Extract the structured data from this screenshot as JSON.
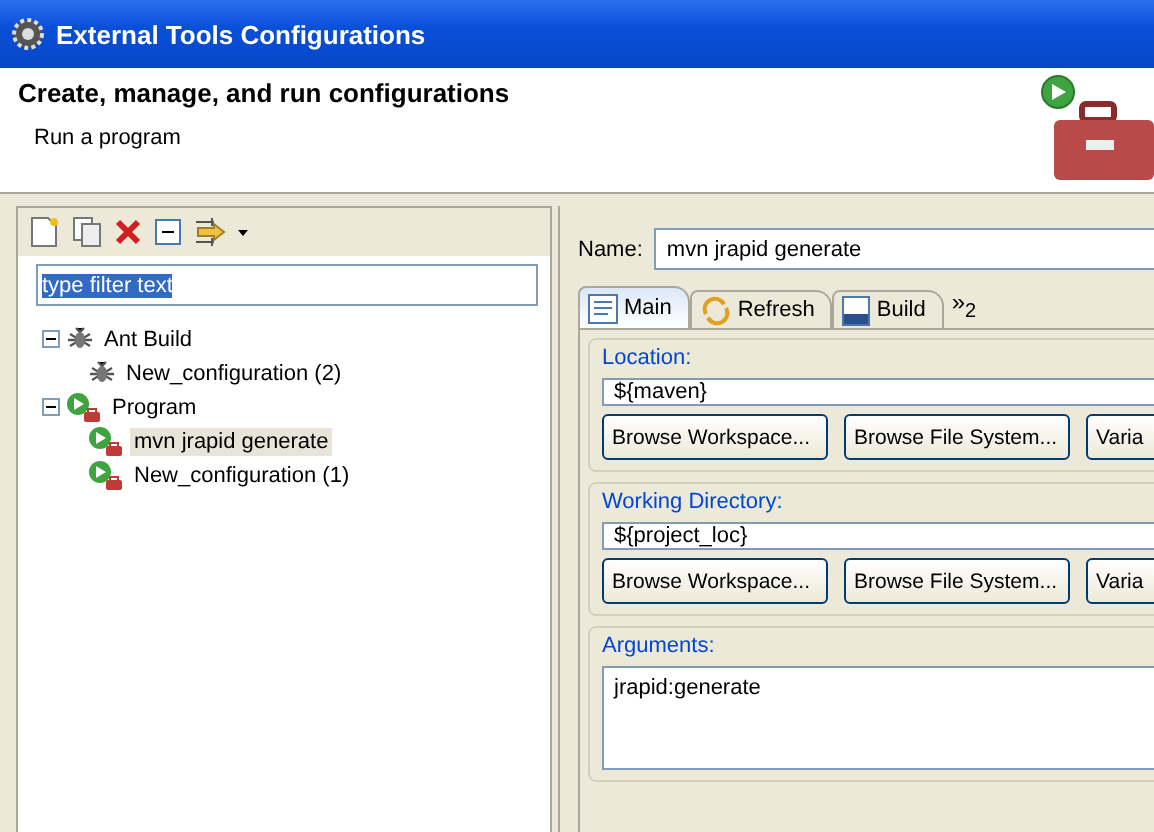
{
  "window": {
    "title": "External Tools Configurations"
  },
  "header": {
    "title": "Create, manage, and run configurations",
    "subtitle": "Run a program"
  },
  "filter": {
    "value": "type filter text",
    "highlighted": true
  },
  "tree": [
    {
      "label": "Ant Build",
      "kind": "ant",
      "expanded": true,
      "selected": false,
      "children": [
        {
          "label": "New_configuration (2)",
          "kind": "ant",
          "selected": false
        }
      ]
    },
    {
      "label": "Program",
      "kind": "program",
      "expanded": true,
      "selected": false,
      "children": [
        {
          "label": "mvn jrapid generate",
          "kind": "program",
          "selected": true
        },
        {
          "label": "New_configuration (1)",
          "kind": "program",
          "selected": false
        }
      ]
    }
  ],
  "name_field": {
    "label": "Name:",
    "value": "mvn jrapid generate"
  },
  "tabs": [
    {
      "label": "Main",
      "kind": "main",
      "selected": true
    },
    {
      "label": "Refresh",
      "kind": "refresh",
      "selected": false
    },
    {
      "label": "Build",
      "kind": "build",
      "selected": false
    }
  ],
  "tab_overflow": {
    "mark": "»",
    "count": "2"
  },
  "groups": [
    {
      "label": "Location:",
      "kind": "field",
      "value": "${maven}",
      "buttons": [
        "Browse Workspace...",
        "Browse File System...",
        "Varia"
      ]
    },
    {
      "label": "Working Directory:",
      "kind": "field",
      "value": "${project_loc}",
      "buttons": [
        "Browse Workspace...",
        "Browse File System...",
        "Varia"
      ]
    },
    {
      "label": "Arguments:",
      "kind": "area",
      "value": "jrapid:generate"
    }
  ]
}
